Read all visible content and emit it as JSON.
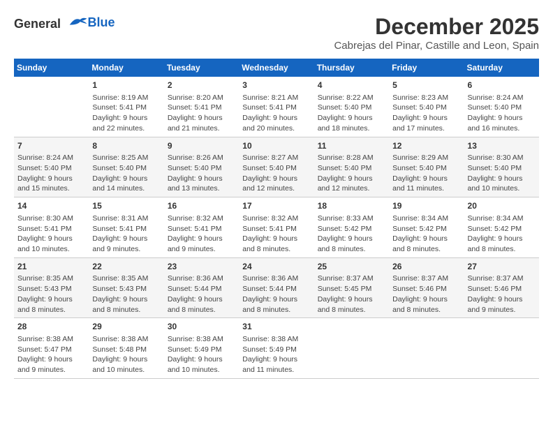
{
  "header": {
    "logo_general": "General",
    "logo_blue": "Blue",
    "month_title": "December 2025",
    "location": "Cabrejas del Pinar, Castille and Leon, Spain"
  },
  "weekdays": [
    "Sunday",
    "Monday",
    "Tuesday",
    "Wednesday",
    "Thursday",
    "Friday",
    "Saturday"
  ],
  "weeks": [
    [
      {
        "day": "",
        "info": ""
      },
      {
        "day": "1",
        "info": "Sunrise: 8:19 AM\nSunset: 5:41 PM\nDaylight: 9 hours\nand 22 minutes."
      },
      {
        "day": "2",
        "info": "Sunrise: 8:20 AM\nSunset: 5:41 PM\nDaylight: 9 hours\nand 21 minutes."
      },
      {
        "day": "3",
        "info": "Sunrise: 8:21 AM\nSunset: 5:41 PM\nDaylight: 9 hours\nand 20 minutes."
      },
      {
        "day": "4",
        "info": "Sunrise: 8:22 AM\nSunset: 5:40 PM\nDaylight: 9 hours\nand 18 minutes."
      },
      {
        "day": "5",
        "info": "Sunrise: 8:23 AM\nSunset: 5:40 PM\nDaylight: 9 hours\nand 17 minutes."
      },
      {
        "day": "6",
        "info": "Sunrise: 8:24 AM\nSunset: 5:40 PM\nDaylight: 9 hours\nand 16 minutes."
      }
    ],
    [
      {
        "day": "7",
        "info": "Sunrise: 8:24 AM\nSunset: 5:40 PM\nDaylight: 9 hours\nand 15 minutes."
      },
      {
        "day": "8",
        "info": "Sunrise: 8:25 AM\nSunset: 5:40 PM\nDaylight: 9 hours\nand 14 minutes."
      },
      {
        "day": "9",
        "info": "Sunrise: 8:26 AM\nSunset: 5:40 PM\nDaylight: 9 hours\nand 13 minutes."
      },
      {
        "day": "10",
        "info": "Sunrise: 8:27 AM\nSunset: 5:40 PM\nDaylight: 9 hours\nand 12 minutes."
      },
      {
        "day": "11",
        "info": "Sunrise: 8:28 AM\nSunset: 5:40 PM\nDaylight: 9 hours\nand 12 minutes."
      },
      {
        "day": "12",
        "info": "Sunrise: 8:29 AM\nSunset: 5:40 PM\nDaylight: 9 hours\nand 11 minutes."
      },
      {
        "day": "13",
        "info": "Sunrise: 8:30 AM\nSunset: 5:40 PM\nDaylight: 9 hours\nand 10 minutes."
      }
    ],
    [
      {
        "day": "14",
        "info": "Sunrise: 8:30 AM\nSunset: 5:41 PM\nDaylight: 9 hours\nand 10 minutes."
      },
      {
        "day": "15",
        "info": "Sunrise: 8:31 AM\nSunset: 5:41 PM\nDaylight: 9 hours\nand 9 minutes."
      },
      {
        "day": "16",
        "info": "Sunrise: 8:32 AM\nSunset: 5:41 PM\nDaylight: 9 hours\nand 9 minutes."
      },
      {
        "day": "17",
        "info": "Sunrise: 8:32 AM\nSunset: 5:41 PM\nDaylight: 9 hours\nand 8 minutes."
      },
      {
        "day": "18",
        "info": "Sunrise: 8:33 AM\nSunset: 5:42 PM\nDaylight: 9 hours\nand 8 minutes."
      },
      {
        "day": "19",
        "info": "Sunrise: 8:34 AM\nSunset: 5:42 PM\nDaylight: 9 hours\nand 8 minutes."
      },
      {
        "day": "20",
        "info": "Sunrise: 8:34 AM\nSunset: 5:42 PM\nDaylight: 9 hours\nand 8 minutes."
      }
    ],
    [
      {
        "day": "21",
        "info": "Sunrise: 8:35 AM\nSunset: 5:43 PM\nDaylight: 9 hours\nand 8 minutes."
      },
      {
        "day": "22",
        "info": "Sunrise: 8:35 AM\nSunset: 5:43 PM\nDaylight: 9 hours\nand 8 minutes."
      },
      {
        "day": "23",
        "info": "Sunrise: 8:36 AM\nSunset: 5:44 PM\nDaylight: 9 hours\nand 8 minutes."
      },
      {
        "day": "24",
        "info": "Sunrise: 8:36 AM\nSunset: 5:44 PM\nDaylight: 9 hours\nand 8 minutes."
      },
      {
        "day": "25",
        "info": "Sunrise: 8:37 AM\nSunset: 5:45 PM\nDaylight: 9 hours\nand 8 minutes."
      },
      {
        "day": "26",
        "info": "Sunrise: 8:37 AM\nSunset: 5:46 PM\nDaylight: 9 hours\nand 8 minutes."
      },
      {
        "day": "27",
        "info": "Sunrise: 8:37 AM\nSunset: 5:46 PM\nDaylight: 9 hours\nand 9 minutes."
      }
    ],
    [
      {
        "day": "28",
        "info": "Sunrise: 8:38 AM\nSunset: 5:47 PM\nDaylight: 9 hours\nand 9 minutes."
      },
      {
        "day": "29",
        "info": "Sunrise: 8:38 AM\nSunset: 5:48 PM\nDaylight: 9 hours\nand 10 minutes."
      },
      {
        "day": "30",
        "info": "Sunrise: 8:38 AM\nSunset: 5:49 PM\nDaylight: 9 hours\nand 10 minutes."
      },
      {
        "day": "31",
        "info": "Sunrise: 8:38 AM\nSunset: 5:49 PM\nDaylight: 9 hours\nand 11 minutes."
      },
      {
        "day": "",
        "info": ""
      },
      {
        "day": "",
        "info": ""
      },
      {
        "day": "",
        "info": ""
      }
    ]
  ]
}
